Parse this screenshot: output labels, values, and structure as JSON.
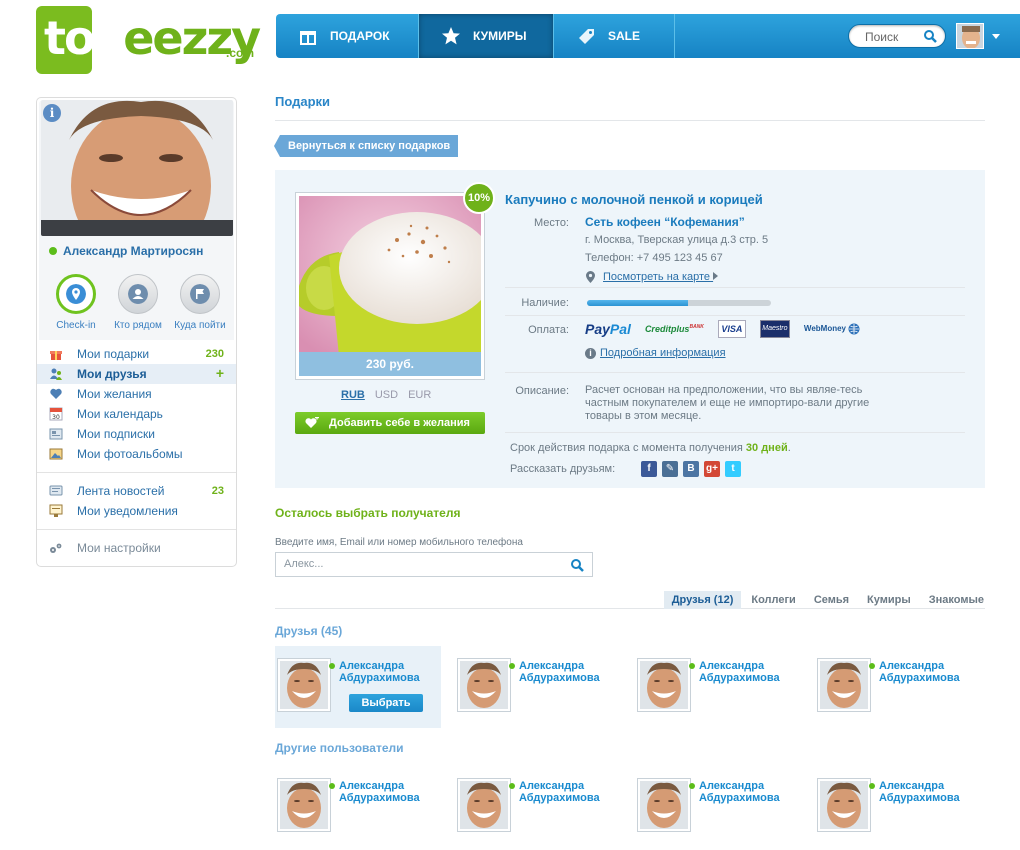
{
  "header": {
    "logo_letters": "tooeezzy",
    "logo_word": "eezzy",
    "logo_domain": ".com",
    "nav": [
      {
        "label": "ПОДАРОК",
        "icon": "gift-icon"
      },
      {
        "label": "КУМИРЫ",
        "icon": "star-icon"
      },
      {
        "label": "SALE",
        "icon": "tag-icon"
      }
    ],
    "active_nav": "КУМИРЫ",
    "search_placeholder": "Поиск"
  },
  "sidebar": {
    "user_name": "Александр Мартиросян",
    "actions": [
      {
        "label": "Check-in",
        "icon": "location-pin-icon"
      },
      {
        "label": "Кто рядом",
        "icon": "person-icon"
      },
      {
        "label": "Куда пойти",
        "icon": "flag-icon"
      }
    ],
    "menu": [
      {
        "label": "Мои подарки",
        "icon": "gift-icon",
        "count": "230"
      },
      {
        "label": "Мои друзья",
        "icon": "friends-icon",
        "count": "+",
        "active": true
      },
      {
        "label": "Мои желания",
        "icon": "heart-icon",
        "count": ""
      },
      {
        "label": "Мои календарь",
        "icon": "calendar-icon",
        "count": ""
      },
      {
        "label": "Мои подписки",
        "icon": "subscriptions-icon",
        "count": ""
      },
      {
        "label": "Мои фотоальбомы",
        "icon": "photo-album-icon",
        "count": ""
      }
    ],
    "menu2": [
      {
        "label": "Лента новостей",
        "icon": "news-icon",
        "count": "23"
      },
      {
        "label": "Мои уведомления",
        "icon": "notifications-icon",
        "count": ""
      }
    ],
    "settings_label": "Мои настройки",
    "calendar_day": "30"
  },
  "main": {
    "title": "Подарки",
    "back_label": "Вернуться к списку подарков",
    "gift": {
      "name": "Капучино с молочной пенкой и корицей",
      "discount": "10%",
      "price": "230 руб.",
      "currencies": [
        "RUB",
        "USD",
        "EUR"
      ],
      "selected_currency": "RUB",
      "wish_label": "Добавить себе в желания",
      "place_label": "Место:",
      "place_name": "Сеть кофеен “Кофемания”",
      "address": "г. Москва, Тверская улица д.3 стр. 5",
      "phone": "Телефон: +7 495 123 45 67",
      "map_link": "Посмотреть на карте",
      "availability_label": "Наличие:",
      "availability_fraction": 0.55,
      "payment_label": "Оплата:",
      "payment_methods": [
        "PayPal",
        "Creditplus",
        "VISA",
        "Maestro",
        "WebMoney"
      ],
      "paypal_pay": "Pay",
      "paypal_pal": "Pal",
      "creditplus_bank": "BANK",
      "details_link": "Подробная информация",
      "description_label": "Описание:",
      "description": "Расчет основан на предположении, что вы являе-тесь частным покупателем и еще не импортиро-вали другие товары в этом месяце.",
      "validity_text": "Срок действия подарка с момента получения",
      "validity_value": "30 дней",
      "validity_end": ".",
      "share_label": "Рассказать друзьям:",
      "share_networks": [
        {
          "name": "facebook",
          "glyph": "f",
          "color": "#3b5998"
        },
        {
          "name": "livejournal",
          "glyph": "✎",
          "color": "#4a6f95"
        },
        {
          "name": "vkontakte",
          "glyph": "B",
          "color": "#4c75a3"
        },
        {
          "name": "google-plus",
          "glyph": "g+",
          "color": "#d34836"
        },
        {
          "name": "twitter",
          "glyph": "t",
          "color": "#33ccff"
        }
      ]
    },
    "recipient": {
      "title": "Осталось выбрать получателя",
      "hint": "Введите имя, Email  или номер мобильного телефона",
      "placeholder": "Алекс...",
      "tabs": [
        "Друзья (12)",
        "Коллеги",
        "Семья",
        "Кумиры",
        "Знакомые"
      ],
      "active_tab": "Друзья (12)",
      "friends_title": "Друзья (45)",
      "others_title": "Другие пользователи",
      "choose_label": "Выбрать",
      "friends": [
        {
          "first": "Александра",
          "last": "Абдурахимова"
        },
        {
          "first": "Александра",
          "last": "Абдурахимова"
        },
        {
          "first": "Александра",
          "last": "Абдурахимова"
        },
        {
          "first": "Александра",
          "last": "Абдурахимова"
        }
      ],
      "others": [
        {
          "first": "Александра",
          "last": "Абдурахимова"
        },
        {
          "first": "Александра",
          "last": "Абдурахимова"
        },
        {
          "first": "Александра",
          "last": "Абдурахимова"
        },
        {
          "first": "Александра",
          "last": "Абдурахимова"
        }
      ]
    }
  },
  "colors": {
    "brand_green": "#6fb21a",
    "brand_blue": "#1a88c8",
    "link_blue": "#2a6fa8"
  }
}
